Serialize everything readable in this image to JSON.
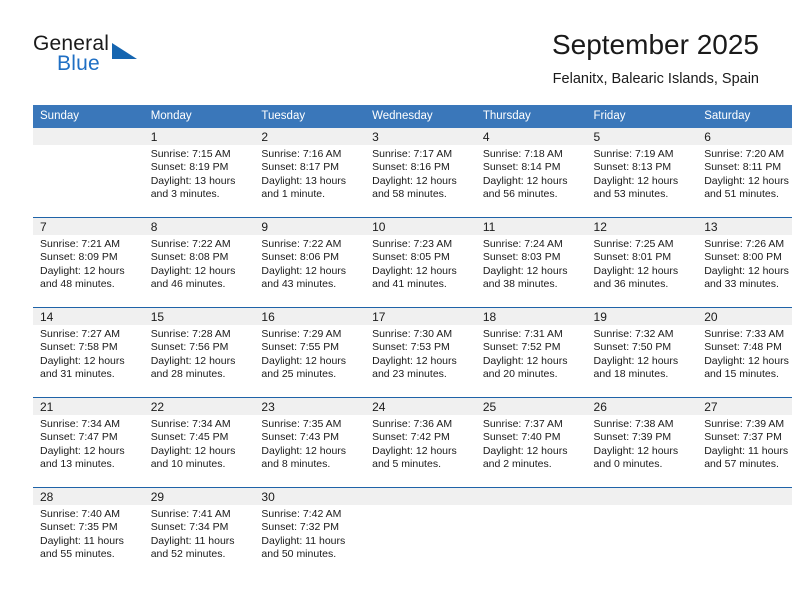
{
  "brand": {
    "name_top": "General",
    "name_bottom": "Blue",
    "triangle_color": "#1565b0",
    "blue_text_color": "#1f6fc4",
    "logo_icon": "triangle-icon"
  },
  "header": {
    "month_title": "September 2025",
    "location": "Felanitx, Balearic Islands, Spain"
  },
  "theme": {
    "header_blue": "#3a77ba",
    "row_divider_blue": "#1f63a8",
    "daynum_band": "#f0f0f0"
  },
  "calendar": {
    "weekday_headers": [
      "Sunday",
      "Monday",
      "Tuesday",
      "Wednesday",
      "Thursday",
      "Friday",
      "Saturday"
    ],
    "weeks": [
      [
        {
          "day": "",
          "sunrise": "",
          "sunset": "",
          "daylight_1": "",
          "daylight_2": ""
        },
        {
          "day": "1",
          "sunrise": "Sunrise: 7:15 AM",
          "sunset": "Sunset: 8:19 PM",
          "daylight_1": "Daylight: 13 hours",
          "daylight_2": "and 3 minutes."
        },
        {
          "day": "2",
          "sunrise": "Sunrise: 7:16 AM",
          "sunset": "Sunset: 8:17 PM",
          "daylight_1": "Daylight: 13 hours",
          "daylight_2": "and 1 minute."
        },
        {
          "day": "3",
          "sunrise": "Sunrise: 7:17 AM",
          "sunset": "Sunset: 8:16 PM",
          "daylight_1": "Daylight: 12 hours",
          "daylight_2": "and 58 minutes."
        },
        {
          "day": "4",
          "sunrise": "Sunrise: 7:18 AM",
          "sunset": "Sunset: 8:14 PM",
          "daylight_1": "Daylight: 12 hours",
          "daylight_2": "and 56 minutes."
        },
        {
          "day": "5",
          "sunrise": "Sunrise: 7:19 AM",
          "sunset": "Sunset: 8:13 PM",
          "daylight_1": "Daylight: 12 hours",
          "daylight_2": "and 53 minutes."
        },
        {
          "day": "6",
          "sunrise": "Sunrise: 7:20 AM",
          "sunset": "Sunset: 8:11 PM",
          "daylight_1": "Daylight: 12 hours",
          "daylight_2": "and 51 minutes."
        }
      ],
      [
        {
          "day": "7",
          "sunrise": "Sunrise: 7:21 AM",
          "sunset": "Sunset: 8:09 PM",
          "daylight_1": "Daylight: 12 hours",
          "daylight_2": "and 48 minutes."
        },
        {
          "day": "8",
          "sunrise": "Sunrise: 7:22 AM",
          "sunset": "Sunset: 8:08 PM",
          "daylight_1": "Daylight: 12 hours",
          "daylight_2": "and 46 minutes."
        },
        {
          "day": "9",
          "sunrise": "Sunrise: 7:22 AM",
          "sunset": "Sunset: 8:06 PM",
          "daylight_1": "Daylight: 12 hours",
          "daylight_2": "and 43 minutes."
        },
        {
          "day": "10",
          "sunrise": "Sunrise: 7:23 AM",
          "sunset": "Sunset: 8:05 PM",
          "daylight_1": "Daylight: 12 hours",
          "daylight_2": "and 41 minutes."
        },
        {
          "day": "11",
          "sunrise": "Sunrise: 7:24 AM",
          "sunset": "Sunset: 8:03 PM",
          "daylight_1": "Daylight: 12 hours",
          "daylight_2": "and 38 minutes."
        },
        {
          "day": "12",
          "sunrise": "Sunrise: 7:25 AM",
          "sunset": "Sunset: 8:01 PM",
          "daylight_1": "Daylight: 12 hours",
          "daylight_2": "and 36 minutes."
        },
        {
          "day": "13",
          "sunrise": "Sunrise: 7:26 AM",
          "sunset": "Sunset: 8:00 PM",
          "daylight_1": "Daylight: 12 hours",
          "daylight_2": "and 33 minutes."
        }
      ],
      [
        {
          "day": "14",
          "sunrise": "Sunrise: 7:27 AM",
          "sunset": "Sunset: 7:58 PM",
          "daylight_1": "Daylight: 12 hours",
          "daylight_2": "and 31 minutes."
        },
        {
          "day": "15",
          "sunrise": "Sunrise: 7:28 AM",
          "sunset": "Sunset: 7:56 PM",
          "daylight_1": "Daylight: 12 hours",
          "daylight_2": "and 28 minutes."
        },
        {
          "day": "16",
          "sunrise": "Sunrise: 7:29 AM",
          "sunset": "Sunset: 7:55 PM",
          "daylight_1": "Daylight: 12 hours",
          "daylight_2": "and 25 minutes."
        },
        {
          "day": "17",
          "sunrise": "Sunrise: 7:30 AM",
          "sunset": "Sunset: 7:53 PM",
          "daylight_1": "Daylight: 12 hours",
          "daylight_2": "and 23 minutes."
        },
        {
          "day": "18",
          "sunrise": "Sunrise: 7:31 AM",
          "sunset": "Sunset: 7:52 PM",
          "daylight_1": "Daylight: 12 hours",
          "daylight_2": "and 20 minutes."
        },
        {
          "day": "19",
          "sunrise": "Sunrise: 7:32 AM",
          "sunset": "Sunset: 7:50 PM",
          "daylight_1": "Daylight: 12 hours",
          "daylight_2": "and 18 minutes."
        },
        {
          "day": "20",
          "sunrise": "Sunrise: 7:33 AM",
          "sunset": "Sunset: 7:48 PM",
          "daylight_1": "Daylight: 12 hours",
          "daylight_2": "and 15 minutes."
        }
      ],
      [
        {
          "day": "21",
          "sunrise": "Sunrise: 7:34 AM",
          "sunset": "Sunset: 7:47 PM",
          "daylight_1": "Daylight: 12 hours",
          "daylight_2": "and 13 minutes."
        },
        {
          "day": "22",
          "sunrise": "Sunrise: 7:34 AM",
          "sunset": "Sunset: 7:45 PM",
          "daylight_1": "Daylight: 12 hours",
          "daylight_2": "and 10 minutes."
        },
        {
          "day": "23",
          "sunrise": "Sunrise: 7:35 AM",
          "sunset": "Sunset: 7:43 PM",
          "daylight_1": "Daylight: 12 hours",
          "daylight_2": "and 8 minutes."
        },
        {
          "day": "24",
          "sunrise": "Sunrise: 7:36 AM",
          "sunset": "Sunset: 7:42 PM",
          "daylight_1": "Daylight: 12 hours",
          "daylight_2": "and 5 minutes."
        },
        {
          "day": "25",
          "sunrise": "Sunrise: 7:37 AM",
          "sunset": "Sunset: 7:40 PM",
          "daylight_1": "Daylight: 12 hours",
          "daylight_2": "and 2 minutes."
        },
        {
          "day": "26",
          "sunrise": "Sunrise: 7:38 AM",
          "sunset": "Sunset: 7:39 PM",
          "daylight_1": "Daylight: 12 hours",
          "daylight_2": "and 0 minutes."
        },
        {
          "day": "27",
          "sunrise": "Sunrise: 7:39 AM",
          "sunset": "Sunset: 7:37 PM",
          "daylight_1": "Daylight: 11 hours",
          "daylight_2": "and 57 minutes."
        }
      ],
      [
        {
          "day": "28",
          "sunrise": "Sunrise: 7:40 AM",
          "sunset": "Sunset: 7:35 PM",
          "daylight_1": "Daylight: 11 hours",
          "daylight_2": "and 55 minutes."
        },
        {
          "day": "29",
          "sunrise": "Sunrise: 7:41 AM",
          "sunset": "Sunset: 7:34 PM",
          "daylight_1": "Daylight: 11 hours",
          "daylight_2": "and 52 minutes."
        },
        {
          "day": "30",
          "sunrise": "Sunrise: 7:42 AM",
          "sunset": "Sunset: 7:32 PM",
          "daylight_1": "Daylight: 11 hours",
          "daylight_2": "and 50 minutes."
        },
        {
          "day": "",
          "sunrise": "",
          "sunset": "",
          "daylight_1": "",
          "daylight_2": ""
        },
        {
          "day": "",
          "sunrise": "",
          "sunset": "",
          "daylight_1": "",
          "daylight_2": ""
        },
        {
          "day": "",
          "sunrise": "",
          "sunset": "",
          "daylight_1": "",
          "daylight_2": ""
        },
        {
          "day": "",
          "sunrise": "",
          "sunset": "",
          "daylight_1": "",
          "daylight_2": ""
        }
      ]
    ]
  }
}
